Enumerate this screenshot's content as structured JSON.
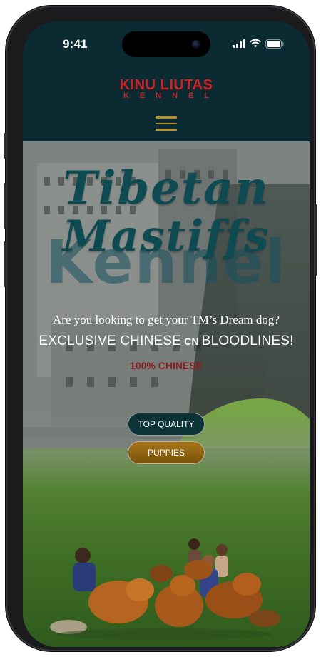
{
  "status_bar": {
    "time": "9:41",
    "icons": [
      "signal-icon",
      "wifi-icon",
      "battery-icon"
    ]
  },
  "header": {
    "logo_main": "KINU LIUTAS",
    "logo_sub": "KENNEL",
    "menu_icon": "hamburger-menu-icon"
  },
  "hero": {
    "title_line1": "Tibetan",
    "title_line2": "Mastiffs",
    "background_word": "Kennel",
    "question": "Are you looking to get your TM’s Dream dog?",
    "exclusive_prefix": "EXCLUSIVE CHINESE",
    "exclusive_code": "CN",
    "exclusive_suffix": "BLOODLINES!",
    "chinese_label": "100% CHINESE",
    "buttons": {
      "quality": "TOP QUALITY",
      "puppies": "PUPPIES"
    }
  },
  "colors": {
    "header_bg": "#0c2a31",
    "logo_red": "#c3262b",
    "menu_gold": "#b8902a",
    "title_teal": "#0d4a52",
    "chinese_red": "#8e1d1f",
    "quality_btn": "#0c3338",
    "puppies_btn": "#a6761a"
  }
}
